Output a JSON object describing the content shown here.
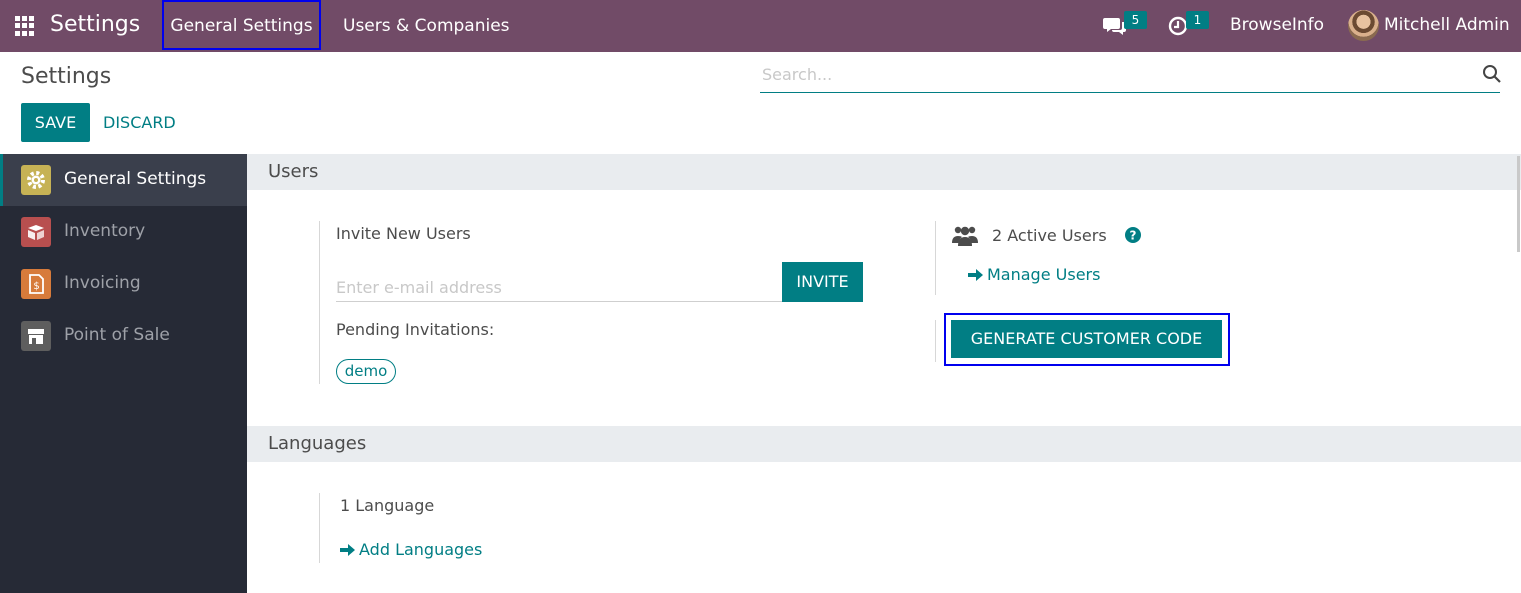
{
  "navbar": {
    "brand": "Settings",
    "menu": [
      "General Settings",
      "Users & Companies"
    ],
    "messages_count": "5",
    "activities_count": "1",
    "company": "BrowseInfo",
    "user": "Mitchell Admin"
  },
  "control_panel": {
    "title": "Settings",
    "search_placeholder": "Search...",
    "save_label": "SAVE",
    "discard_label": "DISCARD"
  },
  "sidebar": {
    "items": [
      {
        "label": "General Settings",
        "icon": "gear-icon",
        "color": "#c6b255"
      },
      {
        "label": "Inventory",
        "icon": "box-icon",
        "color": "#b84f4f"
      },
      {
        "label": "Invoicing",
        "icon": "invoice-icon",
        "color": "#d77b3b"
      },
      {
        "label": "Point of Sale",
        "icon": "store-icon",
        "color": "#5e5e5e"
      }
    ]
  },
  "users_section": {
    "title": "Users",
    "invite_label": "Invite New Users",
    "email_placeholder": "Enter e-mail address",
    "invite_button": "INVITE",
    "pending_label": "Pending Invitations:",
    "pending": [
      "demo"
    ],
    "active_users": "2 Active Users",
    "manage_users": "Manage Users",
    "generate_button": "GENERATE CUSTOMER CODE"
  },
  "languages_section": {
    "title": "Languages",
    "count": "1 Language",
    "add_languages": "Add Languages"
  },
  "colors": {
    "navbar": "#714b67",
    "accent": "#017e84",
    "sidebar": "#262a36",
    "highlight_border": "#0000ee"
  }
}
